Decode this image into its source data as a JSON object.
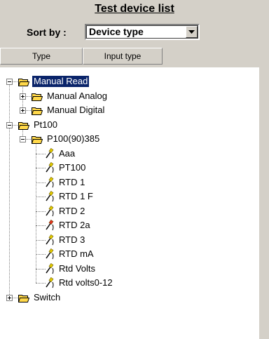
{
  "title": "Test device list",
  "sort": {
    "label": "Sort by :",
    "value": "Device type"
  },
  "columns": [
    "Type",
    "Input type"
  ],
  "tree": [
    {
      "label": "Manual Read",
      "level": 0,
      "expander": "minus",
      "icon": "folder-open-icon",
      "selected": true,
      "line": "vertical"
    },
    {
      "label": "Manual Analog",
      "level": 1,
      "expander": "plus",
      "icon": "folder-open-icon"
    },
    {
      "label": "Manual Digital",
      "level": 1,
      "expander": "plus",
      "icon": "folder-open-icon"
    },
    {
      "label": "Pt100",
      "level": 0,
      "expander": "minus",
      "icon": "folder-open-icon"
    },
    {
      "label": "P100(90)385",
      "level": 1,
      "expander": "minus",
      "icon": "folder-open-icon"
    },
    {
      "label": "Aaa",
      "level": 2,
      "icon": "probe-icon"
    },
    {
      "label": "PT100",
      "level": 2,
      "icon": "probe-icon"
    },
    {
      "label": "RTD 1",
      "level": 2,
      "icon": "probe-icon"
    },
    {
      "label": "RTD 1 F",
      "level": 2,
      "icon": "probe-icon"
    },
    {
      "label": "RTD 2",
      "level": 2,
      "icon": "probe-icon"
    },
    {
      "label": "RTD 2a",
      "level": 2,
      "icon": "probe-icon",
      "alert": true
    },
    {
      "label": "RTD 3",
      "level": 2,
      "icon": "probe-icon"
    },
    {
      "label": "RTD mA",
      "level": 2,
      "icon": "probe-icon"
    },
    {
      "label": "Rtd Volts",
      "level": 2,
      "icon": "probe-icon"
    },
    {
      "label": "Rtd volts0-12",
      "level": 2,
      "icon": "probe-icon"
    },
    {
      "label": "Switch",
      "level": 0,
      "expander": "plus",
      "icon": "folder-open-icon"
    }
  ],
  "colors": {
    "selection": "#0a246a",
    "folder": "#ffd84a",
    "probe": "#e0c800",
    "probe_alert": "#e03020"
  }
}
